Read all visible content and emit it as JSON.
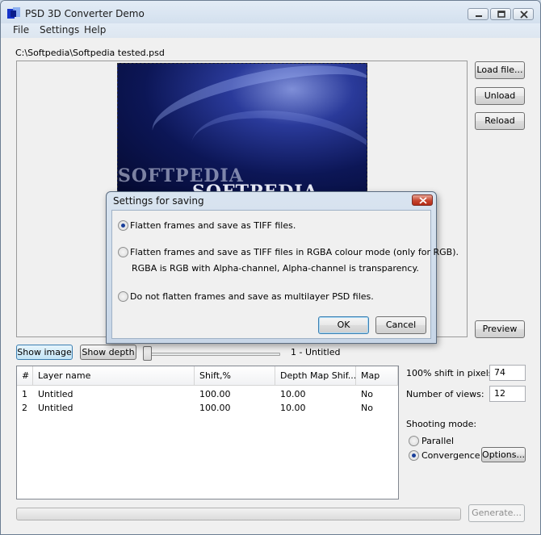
{
  "window": {
    "title": "PSD 3D Converter Demo"
  },
  "menu": [
    "File",
    "Settings",
    "Help"
  ],
  "file_path": "C:\\Softpedia\\Softpedia tested.psd",
  "preview_watermark": "SOFTPEDIA",
  "preview_watermark2": "SOFTPEDIA",
  "buttons": {
    "load_file": "Load file...",
    "unload": "Unload",
    "reload": "Reload",
    "preview": "Preview",
    "show_image": "Show image",
    "show_depth": "Show depth",
    "options": "Options...",
    "generate": "Generate..."
  },
  "slider": {
    "value_label": "1 - Untitled",
    "position": 0
  },
  "layers_table": {
    "columns": [
      "#",
      "Layer name",
      "Shift,%",
      "Depth Map Shif...",
      "Map"
    ],
    "rows": [
      [
        "1",
        "Untitled",
        "100.00",
        "10.00",
        "No"
      ],
      [
        "2",
        "Untitled",
        "100.00",
        "10.00",
        "No"
      ]
    ]
  },
  "right_panel": {
    "shift_label": "100% shift in pixels:",
    "shift_value": "74",
    "views_label": "Number of views:",
    "views_value": "12",
    "shooting_mode_label": "Shooting mode:",
    "mode_parallel": "Parallel",
    "mode_convergence": "Convergence",
    "selected_mode": "Convergence"
  },
  "dialog": {
    "title": "Settings for saving",
    "option1": "Flatten frames and save as TIFF files.",
    "option2_line1": "Flatten frames and save as TIFF files in  RGBA colour mode (only for RGB).",
    "option2_line2": "RGBA is RGB with Alpha-channel, Alpha-channel is transparency.",
    "option3": "Do not flatten frames and save as multilayer PSD files.",
    "selected_option": 1,
    "ok": "OK",
    "cancel": "Cancel"
  },
  "progress": 0
}
